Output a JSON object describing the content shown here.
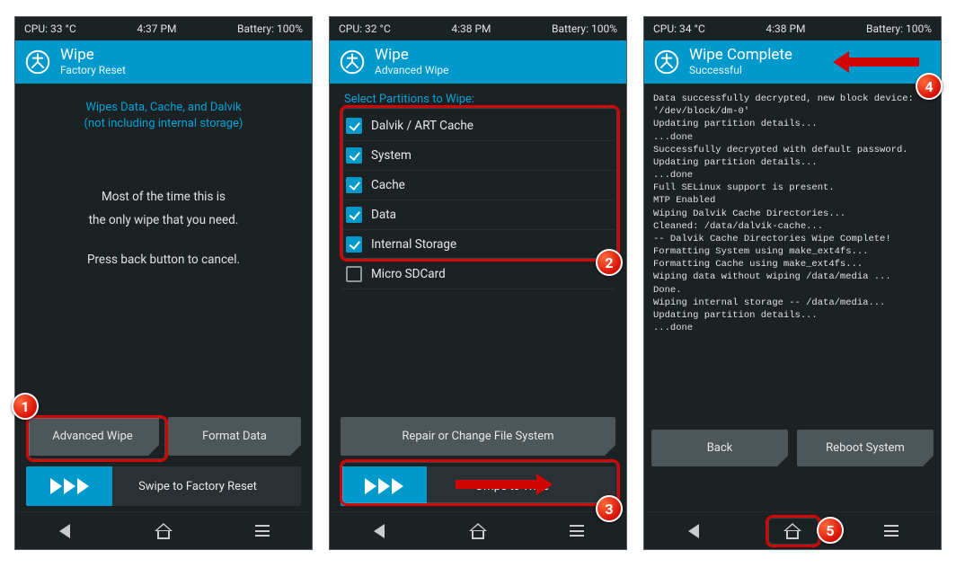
{
  "screen1": {
    "status": {
      "cpu": "CPU: 33 °C",
      "time": "4:37 PM",
      "battery": "Battery: 100%"
    },
    "title": "Wipe",
    "subtitle": "Factory Reset",
    "note_line1": "Wipes Data, Cache, and Dalvik",
    "note_line2": "(not including internal storage)",
    "info_line1": "Most of the time this is",
    "info_line2": "the only wipe that you need.",
    "info_line3": "Press back button to cancel.",
    "btn_advanced": "Advanced Wipe",
    "btn_format": "Format Data",
    "swipe_label": "Swipe to Factory Reset"
  },
  "screen2": {
    "status": {
      "cpu": "CPU: 32 °C",
      "time": "4:38 PM",
      "battery": "Battery: 100%"
    },
    "title": "Wipe",
    "subtitle": "Advanced Wipe",
    "section": "Select Partitions to Wipe:",
    "items": [
      {
        "label": "Dalvik / ART Cache",
        "checked": true
      },
      {
        "label": "System",
        "checked": true
      },
      {
        "label": "Cache",
        "checked": true
      },
      {
        "label": "Data",
        "checked": true
      },
      {
        "label": "Internal Storage",
        "checked": true
      },
      {
        "label": "Micro SDCard",
        "checked": false
      }
    ],
    "btn_repair": "Repair or Change File System",
    "swipe_label": "Swipe to Wipe"
  },
  "screen3": {
    "status": {
      "cpu": "CPU: 34 °C",
      "time": "4:38 PM",
      "battery": "Battery: 100%"
    },
    "title": "Wipe Complete",
    "subtitle": "Successful",
    "log": "Data successfully decrypted, new block device: '/dev/block/dm-0'\nUpdating partition details...\n...done\nSuccessfully decrypted with default password.\nUpdating partition details...\n...done\nFull SELinux support is present.\nMTP Enabled\nWiping Dalvik Cache Directories...\nCleaned: /data/dalvik-cache...\n-- Dalvik Cache Directories Wipe Complete!\nFormatting System using make_ext4fs...\nFormatting Cache using make_ext4fs...\nWiping data without wiping /data/media ...\nDone.\nWiping internal storage -- /data/media...\nUpdating partition details...\n...done",
    "btn_back": "Back",
    "btn_reboot": "Reboot System"
  },
  "callouts": {
    "c1": "1",
    "c2": "2",
    "c3": "3",
    "c4": "4",
    "c5": "5"
  }
}
